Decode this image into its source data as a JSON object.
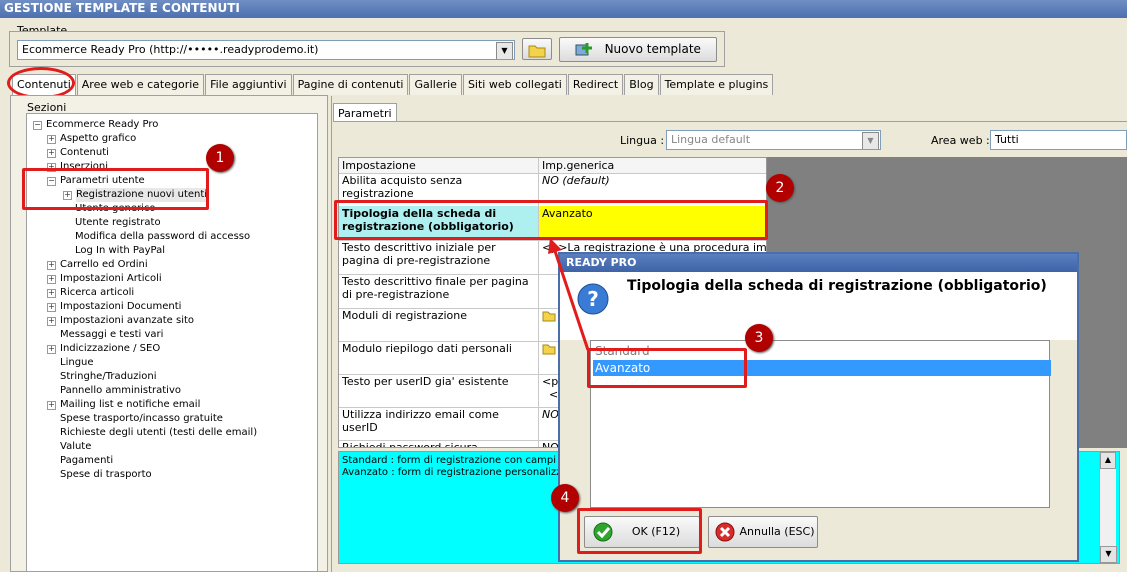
{
  "window": {
    "title": "GESTIONE TEMPLATE E CONTENUTI"
  },
  "template": {
    "group_label": "Template",
    "value": "Ecommerce Ready Pro (http://•••••.readyprodemo.it)",
    "new_button_label": "Nuovo template"
  },
  "tabs": [
    "Contenuti",
    "Aree web e categorie",
    "File aggiuntivi",
    "Pagine di contenuti",
    "Gallerie",
    "Siti web collegati",
    "Redirect",
    "Blog",
    "Template e plugins"
  ],
  "sections": {
    "label": "Sezioni",
    "tree": [
      {
        "label": "Ecommerce Ready Pro",
        "level": 0,
        "expander": "minus"
      },
      {
        "label": "Aspetto grafico",
        "level": 1,
        "expander": "plus"
      },
      {
        "label": "Contenuti",
        "level": 1,
        "expander": "plus"
      },
      {
        "label": "Inserzioni",
        "level": 1,
        "expander": "plus"
      },
      {
        "label": "Parametri utente",
        "level": 1,
        "expander": "minus"
      },
      {
        "label": "Registrazione nuovi utenti",
        "level": 2,
        "expander": "plus",
        "selected": true
      },
      {
        "label": "Utente generico",
        "level": 2,
        "expander": "none"
      },
      {
        "label": "Utente registrato",
        "level": 2,
        "expander": "none"
      },
      {
        "label": "Modifica della password di accesso",
        "level": 2,
        "expander": "none"
      },
      {
        "label": "Log In with PayPal",
        "level": 2,
        "expander": "none"
      },
      {
        "label": "Carrello ed Ordini",
        "level": 1,
        "expander": "plus"
      },
      {
        "label": "Impostazioni Articoli",
        "level": 1,
        "expander": "plus"
      },
      {
        "label": "Ricerca articoli",
        "level": 1,
        "expander": "plus"
      },
      {
        "label": "Impostazioni Documenti",
        "level": 1,
        "expander": "plus"
      },
      {
        "label": "Impostazioni avanzate sito",
        "level": 1,
        "expander": "plus"
      },
      {
        "label": "Messaggi e testi vari",
        "level": 1,
        "expander": "none"
      },
      {
        "label": "Indicizzazione / SEO",
        "level": 1,
        "expander": "plus"
      },
      {
        "label": "Lingue",
        "level": 1,
        "expander": "none"
      },
      {
        "label": "Stringhe/Traduzioni",
        "level": 1,
        "expander": "none"
      },
      {
        "label": "Pannello amministrativo",
        "level": 1,
        "expander": "none"
      },
      {
        "label": "Mailing list e notifiche email",
        "level": 1,
        "expander": "plus"
      },
      {
        "label": "Spese trasporto/incasso gratuite",
        "level": 1,
        "expander": "none"
      },
      {
        "label": "Richieste degli utenti (testi delle email)",
        "level": 1,
        "expander": "none"
      },
      {
        "label": "Valute",
        "level": 1,
        "expander": "none"
      },
      {
        "label": "Pagamenti",
        "level": 1,
        "expander": "none"
      },
      {
        "label": "Spese di trasporto",
        "level": 1,
        "expander": "none"
      }
    ]
  },
  "params": {
    "tab_label": "Parametri",
    "lingua_label": "Lingua :",
    "lingua_value": "Lingua default",
    "area_label": "Area web :",
    "area_value": "Tutti",
    "col_setting": "Impostazione",
    "col_value": "Imp.generica",
    "rows": [
      {
        "setting": "Abilita acquisto senza registrazione",
        "value": "NO (default)",
        "italic": true
      },
      {
        "setting": "Tipologia della scheda di registrazione (obbligatorio)",
        "value": "Avanzato",
        "highlight": true
      },
      {
        "setting": "Testo descrittivo iniziale per pagina di pre-registrazione",
        "value": "<p>La registrazione è una procedura im..."
      },
      {
        "setting": "Testo descrittivo finale per pagina di pre-registrazione",
        "value": ""
      },
      {
        "setting": "Moduli di registrazione",
        "value": "",
        "icon": "folder-icon"
      },
      {
        "setting": "Modulo riepilogo dati personali",
        "value": "",
        "icon": "folder-icon"
      },
      {
        "setting": "Testo per userID gia' esistente",
        "value": "<p>\n  <s"
      },
      {
        "setting": "Utilizza indirizzo email come userID",
        "value": "NO",
        "italic": true
      },
      {
        "setting": "Richiedi password sicura",
        "value": "NO"
      }
    ],
    "description_lines": [
      "Standard : form di registrazione con campi base",
      "Avanzato : form di registrazione personalizzabile"
    ]
  },
  "dialog": {
    "title": "READY PRO",
    "question": "Tipologia della scheda di registrazione (obbligatorio)",
    "options": [
      "Standard",
      "Avanzato"
    ],
    "selected": "Avanzato",
    "ok_label": "OK (F12)",
    "cancel_label": "Annulla (ESC)"
  },
  "annotations": [
    "1",
    "2",
    "3",
    "4"
  ],
  "colors": {
    "highlight_yellow": "#ffff00",
    "highlight_cyan": "#aef0f0",
    "description_cyan": "#00ffff",
    "annotation_red": "#e01c1c",
    "selection_blue": "#3399ff"
  }
}
